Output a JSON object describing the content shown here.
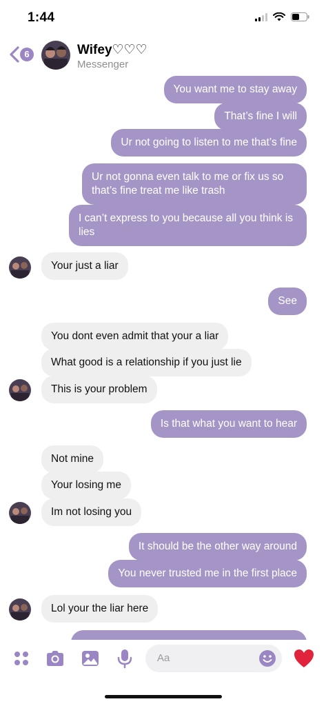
{
  "status_bar": {
    "time": "1:44"
  },
  "header": {
    "back_count": "6",
    "contact_name": "Wifey♡♡♡",
    "contact_sub": "Messenger"
  },
  "messages": [
    {
      "dir": "out",
      "text": "You want me to stay away"
    },
    {
      "dir": "out",
      "text": "That’s fine I will"
    },
    {
      "dir": "out",
      "text": "Ur not going to listen to me that’s fine"
    },
    {
      "dir": "out",
      "text": "Ur not gonna even talk to me or fix us so that’s fine treat me like trash"
    },
    {
      "dir": "out",
      "text": "I can’t express to you because all you think is lies"
    },
    {
      "dir": "in",
      "text": "Your just a liar"
    },
    {
      "dir": "out",
      "text": "See"
    },
    {
      "dir": "in",
      "text": "You dont even admit that your a liar"
    },
    {
      "dir": "in",
      "text": "What good is a relationship if you just lie"
    },
    {
      "dir": "in",
      "text": "This is your problem"
    },
    {
      "dir": "out",
      "text": "Is that what you want to hear"
    },
    {
      "dir": "in",
      "text": "Not mine"
    },
    {
      "dir": "in",
      "text": "Your losing me"
    },
    {
      "dir": "in",
      "text": "Im not losing you"
    },
    {
      "dir": "out",
      "text": "It should be the other way around"
    },
    {
      "dir": "out",
      "text": "You never trusted me in the first place"
    },
    {
      "dir": "in",
      "text": "Lol your the liar here"
    }
  ],
  "composer": {
    "placeholder": "Aa"
  },
  "colors": {
    "accent": "#9b86c4",
    "outgoing_bubble": "#a595c7",
    "incoming_bubble": "#efefef",
    "heart": "#e0243c"
  },
  "icons": [
    "back-chevron-icon",
    "apps-icon",
    "camera-icon",
    "photo-icon",
    "microphone-icon",
    "emoji-icon",
    "heart-icon"
  ]
}
